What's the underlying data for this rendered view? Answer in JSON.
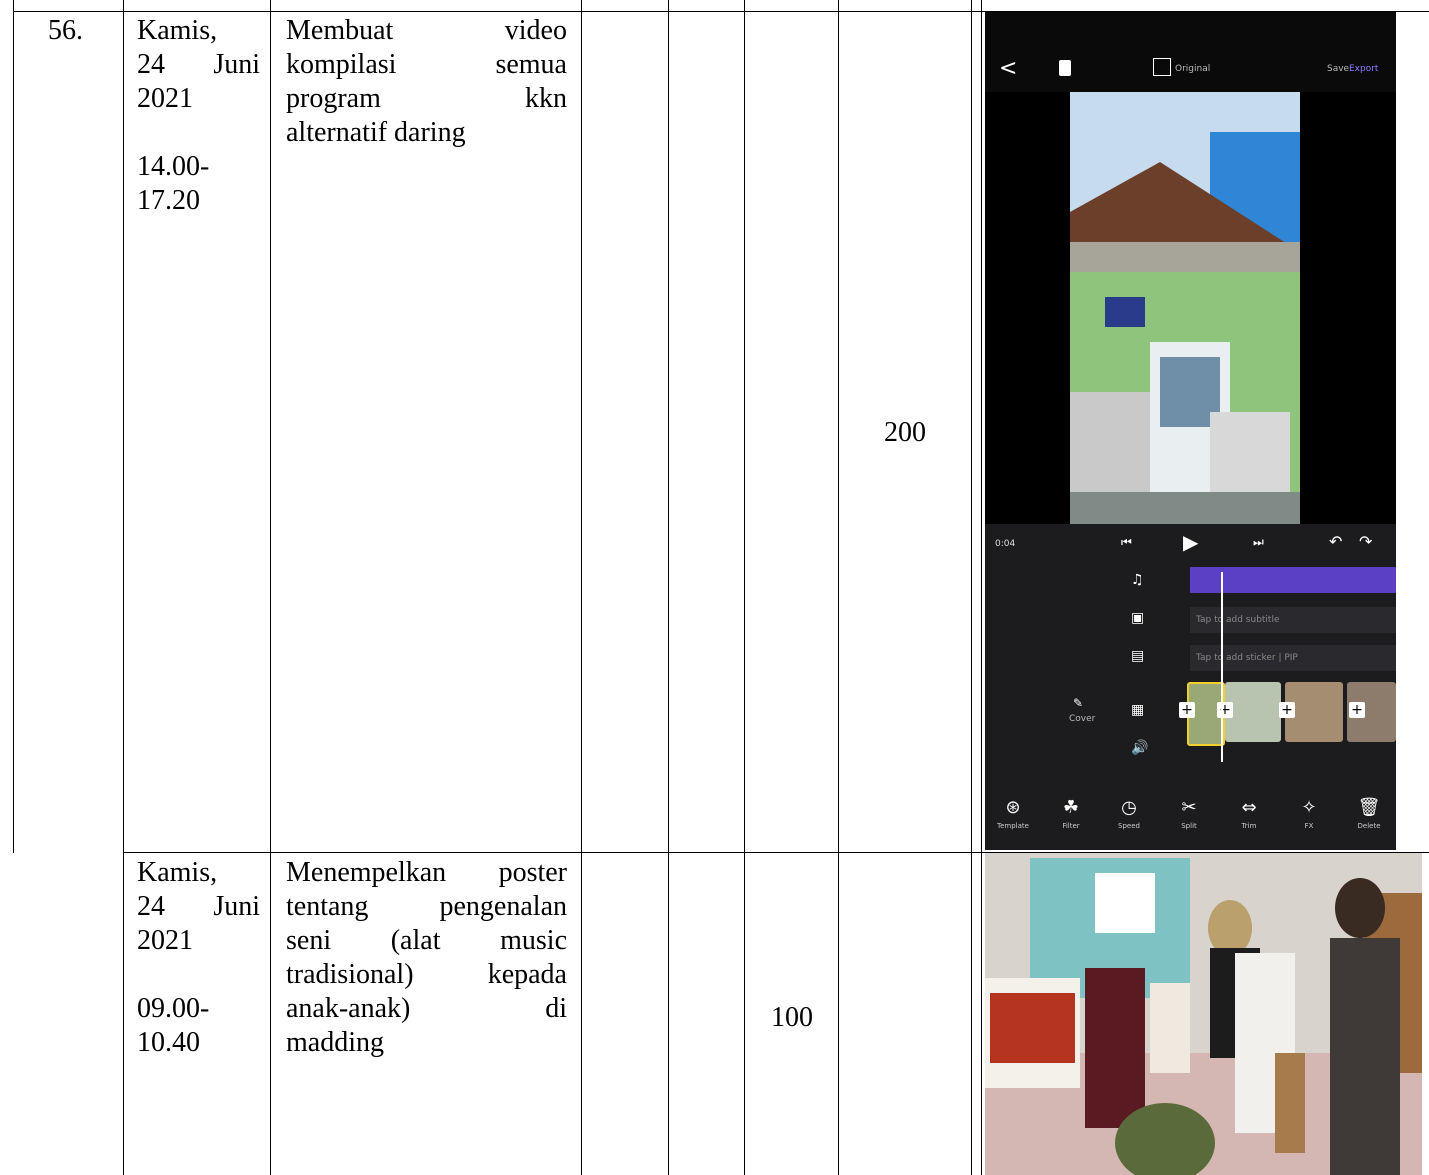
{
  "rows": [
    {
      "no": "56.",
      "date_lines": [
        "Kamis,",
        "24 Juni",
        "2021"
      ],
      "time_lines": [
        "14.00-",
        "17.20"
      ],
      "activity_lines": [
        "Membuat video",
        "kompilasi semua",
        "program kkn",
        "alternatif daring"
      ],
      "hours_value": "200",
      "photo": {
        "top_bar": {
          "back": "<",
          "aspect_label": "Original",
          "save_label": "Save",
          "export_label": "Export"
        },
        "timecode": "0:04",
        "tracks": [
          "",
          "Tap to add subtitle",
          "Tap to add sticker | PIP"
        ],
        "cover_label": "Cover",
        "tools": [
          {
            "icon": "⊛",
            "label": "Template"
          },
          {
            "icon": "☘",
            "label": "Filter"
          },
          {
            "icon": "◷",
            "label": "Speed"
          },
          {
            "icon": "✂",
            "label": "Split"
          },
          {
            "icon": "⇔",
            "label": "Trim"
          },
          {
            "icon": "✧",
            "label": "FX"
          },
          {
            "icon": "🗑",
            "label": "Delete"
          }
        ]
      }
    },
    {
      "date_lines": [
        "Kamis,",
        "24 Juni",
        "2021"
      ],
      "time_lines": [
        "09.00-",
        "10.40"
      ],
      "activity_lines": [
        "Menempelkan poster",
        "tentang pengenalan",
        "seni (alat music",
        "tradisional) kepada",
        "anak-anak) di",
        "madding"
      ],
      "hours_value": "100"
    }
  ],
  "colors": {
    "accent_purple": "#5b3fc4",
    "wall_green": "#8ebf7a"
  }
}
